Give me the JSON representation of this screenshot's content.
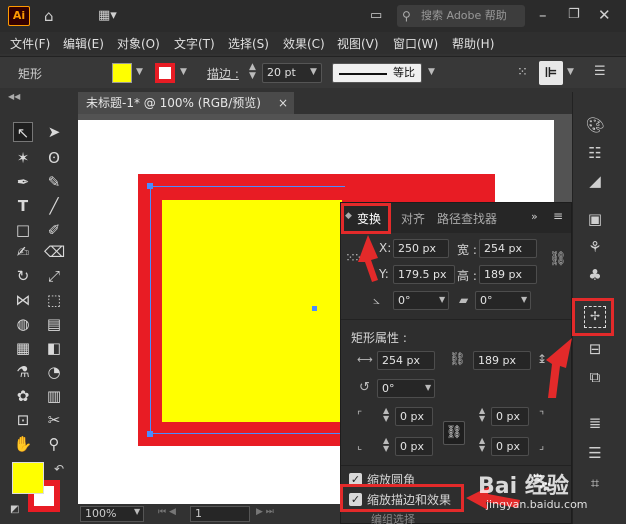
{
  "app": {
    "logo": "Ai",
    "search_placeholder": "搜索 Adobe 帮助"
  },
  "menu": [
    "文件(F)",
    "编辑(E)",
    "对象(O)",
    "文字(T)",
    "选择(S)",
    "效果(C)",
    "视图(V)",
    "窗口(W)",
    "帮助(H)"
  ],
  "control": {
    "shape_label": "矩形",
    "stroke_label": "描边 :",
    "stroke_value": "20 pt",
    "profile_label": "等比"
  },
  "doc": {
    "tab_title": "未标题-1* @ 100% (RGB/预览)",
    "close": "×"
  },
  "status": {
    "zoom": "100%",
    "page": "1"
  },
  "panel": {
    "tabs": [
      "变换",
      "对齐",
      "路径查找器"
    ],
    "x_label": "X:",
    "x_value": "250 px",
    "w_label": "宽 :",
    "w_value": "254 px",
    "y_label": "Y:",
    "y_value": "179.5 px",
    "h_label": "高 :",
    "h_value": "189 px",
    "angle_value": "0°",
    "shear_value": "0°",
    "rect_props_label": "矩形属性 :",
    "rect_w": "254 px",
    "rect_h": "189 px",
    "rotate_value": "0°",
    "corner1": "0 px",
    "corner2": "0 px",
    "corner3": "0 px",
    "corner4": "0 px",
    "scale_corners": "缩放圆角",
    "scale_strokes": "缩放描边和效果",
    "cut_text": "编组选择"
  },
  "watermark": {
    "brand": "Bai  经验",
    "url": "jingyan.baidu.com"
  },
  "colors": {
    "fill": "#ffff00",
    "stroke": "#e81c24",
    "highlight": "#e32a2a",
    "selection": "#4a8cff"
  }
}
